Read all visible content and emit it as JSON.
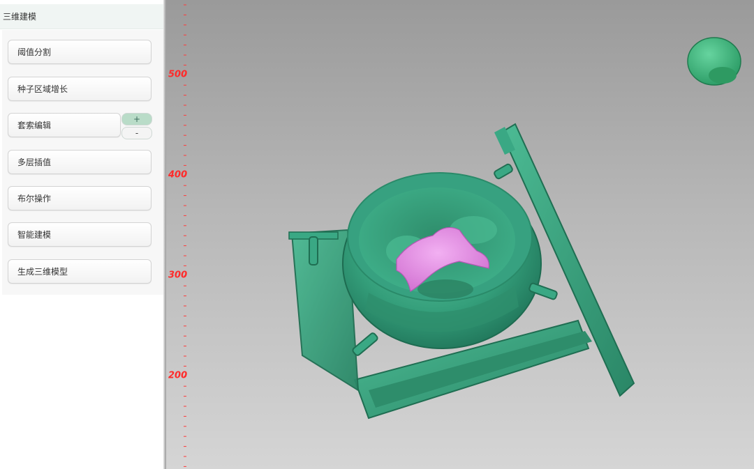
{
  "panel": {
    "title": "三维建模",
    "tools": [
      {
        "label": "阈值分割"
      },
      {
        "label": "种子区域增长"
      },
      {
        "label": "套索编辑"
      },
      {
        "label": "多层插值"
      },
      {
        "label": "布尔操作"
      },
      {
        "label": "智能建模"
      },
      {
        "label": "生成三维模型"
      }
    ],
    "stepper": {
      "plus": "+",
      "minus": "-"
    }
  },
  "viewport": {
    "ruler_labels": [
      "500",
      "400",
      "300",
      "200"
    ],
    "ruler_color": "#ff2a2a",
    "model_color": "#3aa884",
    "highlight_color": "#e58ee6",
    "orientation_widget": "head-orientation-icon"
  }
}
